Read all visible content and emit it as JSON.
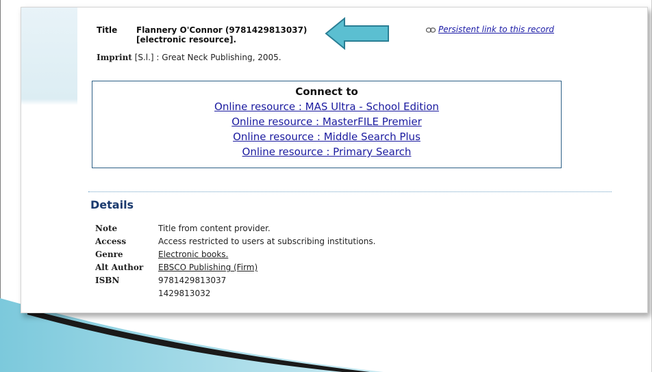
{
  "record": {
    "title_label": "Title",
    "title_value": "Flannery O'Connor (9781429813037) [electronic resource].",
    "imprint_label": "Imprint",
    "imprint_value": " [S.l.] : Great Neck Publishing, 2005.",
    "persistent_link": "Persistent link to this record"
  },
  "connect": {
    "heading": "Connect to",
    "links": [
      "Online resource : MAS Ultra - School Edition",
      "Online resource : MasterFILE Premier",
      "Online resource : Middle Search Plus",
      "Online resource : Primary Search"
    ]
  },
  "details": {
    "heading": "Details",
    "rows": [
      {
        "label": "Note",
        "value": "Title from content provider."
      },
      {
        "label": "Access",
        "value": "Access restricted to users at subscribing institutions."
      },
      {
        "label": "Genre",
        "value": "Electronic books."
      },
      {
        "label": "Alt Author",
        "value": "EBSCO Publishing (Firm)"
      },
      {
        "label": "ISBN",
        "value": "9781429813037"
      },
      {
        "label": "",
        "value": "1429813032"
      }
    ]
  },
  "icons": {
    "arrow": "left-arrow-annotation-icon",
    "persistent": "chain-link-icon"
  },
  "colors": {
    "link": "#1a1a9f",
    "heading": "#1a3a6e",
    "arrow_fill": "#5bbfd1",
    "arrow_stroke": "#2a7e94",
    "box_border": "#2c5f86"
  }
}
